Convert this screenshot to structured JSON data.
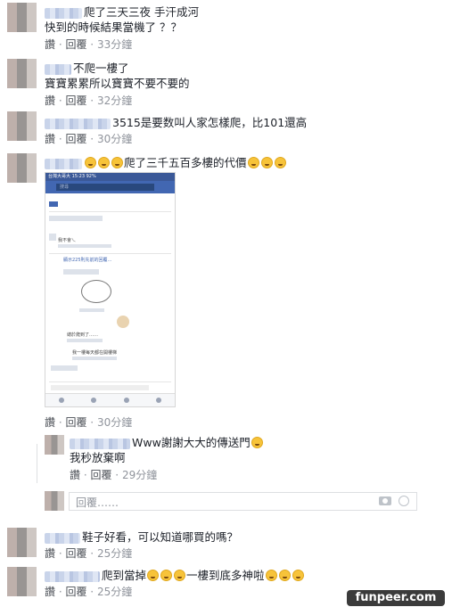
{
  "comments": [
    {
      "text": "爬了三天三夜 手汗成河",
      "text2": "快到的時候結果當機了 ？？",
      "like": "讚",
      "reply": "回覆",
      "time": "33分鐘"
    },
    {
      "text": "不爬一樓了",
      "text2": "寶寶累累所以寶寶不要不要的",
      "like": "讚",
      "reply": "回覆",
      "time": "32分鐘"
    },
    {
      "text": "3515是要数叫人家怎樣爬，比101還高",
      "like": "讚",
      "reply": "回覆",
      "time": "30分鐘"
    },
    {
      "text": "爬了三千五百多樓的代價",
      "like": "讚",
      "reply": "回覆",
      "time": "30分鐘"
    },
    {
      "text": "鞋子好看，可以知道哪買的嗎？",
      "like": "讚",
      "reply": "回覆",
      "time": "25分鐘"
    },
    {
      "text": "爬到當掉",
      "text_tail": "一樓到底多神啦",
      "like": "讚",
      "reply": "回覆",
      "time": "25分鐘"
    }
  ],
  "nested_reply": {
    "text": "Www謝謝大大的傳送門",
    "text2": "我秒放棄啊",
    "like": "讚",
    "reply": "回覆",
    "time": "29分鐘"
  },
  "reply_box": {
    "placeholder": "回覆……"
  },
  "embedded_screenshot": {
    "status": "台灣大哥大 15:23 92%",
    "search": "搜尋",
    "lines": [
      "我不會乀",
      "顯示225則先前的回覆…",
      "總於爬到了……",
      "我一樓每天都在開樓梯"
    ]
  },
  "watermark": "funpeer.com"
}
